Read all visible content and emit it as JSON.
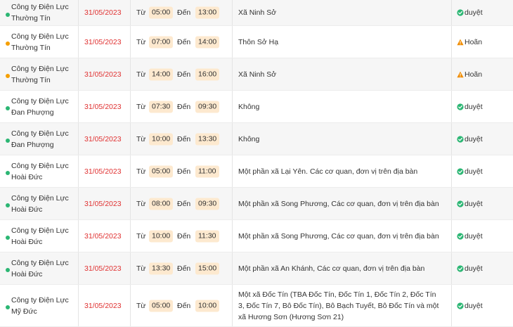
{
  "colors": {
    "dot_green": "#2bb673",
    "dot_orange": "#f59f00",
    "date_red": "#e03131",
    "time_badge_bg": "#fde9cf",
    "approved_icon": "#2bb673",
    "postponed_icon": "#f08c00"
  },
  "labels": {
    "from": "Từ",
    "to": "Đến"
  },
  "rows": [
    {
      "company": "Công ty Điện Lực Thường Tín",
      "date": "31/05/2023",
      "from": "05:00",
      "to": "13:00",
      "area": "Xã Ninh Sở",
      "status": "duyệt",
      "status_icon": "check-circle-icon",
      "dot": "green"
    },
    {
      "company": "Công ty Điện Lực Thường Tín",
      "date": "31/05/2023",
      "from": "07:00",
      "to": "14:00",
      "area": "Thôn Sở Hạ",
      "status": "Hoãn",
      "status_icon": "warning-icon",
      "dot": "orange"
    },
    {
      "company": "Công ty Điện Lực Thường Tín",
      "date": "31/05/2023",
      "from": "14:00",
      "to": "16:00",
      "area": "Xã Ninh Sở",
      "status": "Hoãn",
      "status_icon": "warning-icon",
      "dot": "orange"
    },
    {
      "company": "Công ty Điện Lực Đan Phượng",
      "date": "31/05/2023",
      "from": "07:30",
      "to": "09:30",
      "area": "Không",
      "status": "duyệt",
      "status_icon": "check-circle-icon",
      "dot": "green"
    },
    {
      "company": "Công ty Điện Lực Đan Phượng",
      "date": "31/05/2023",
      "from": "10:00",
      "to": "13:30",
      "area": "Không",
      "status": "duyệt",
      "status_icon": "check-circle-icon",
      "dot": "green"
    },
    {
      "company": "Công ty Điện Lực Hoài Đức",
      "date": "31/05/2023",
      "from": "05:00",
      "to": "11:00",
      "area": "Một phần xã Lại Yên. Các cơ quan, đơn vị trên địa bàn",
      "status": "duyệt",
      "status_icon": "check-circle-icon",
      "dot": "green"
    },
    {
      "company": "Công ty Điện Lực Hoài Đức",
      "date": "31/05/2023",
      "from": "08:00",
      "to": "09:30",
      "area": "Một phần xã Song Phương, Các cơ quan, đơn vị trên địa bàn",
      "status": "duyệt",
      "status_icon": "check-circle-icon",
      "dot": "green"
    },
    {
      "company": "Công ty Điện Lực Hoài Đức",
      "date": "31/05/2023",
      "from": "10:00",
      "to": "11:30",
      "area": "Một phần xã Song Phương, Các cơ quan, đơn vị trên địa bàn",
      "status": "duyệt",
      "status_icon": "check-circle-icon",
      "dot": "green"
    },
    {
      "company": "Công ty Điện Lực Hoài Đức",
      "date": "31/05/2023",
      "from": "13:30",
      "to": "15:00",
      "area": "Một phần xã An Khánh, Các cơ quan, đơn vị trên địa bàn",
      "status": "duyệt",
      "status_icon": "check-circle-icon",
      "dot": "green"
    },
    {
      "company": "Công ty Điện Lực Mỹ Đức",
      "date": "31/05/2023",
      "from": "05:00",
      "to": "10:00",
      "area": "Một xã Đốc Tín (TBA Đốc Tín, Đốc Tín 1, Đốc Tín 2, Đốc Tín 3, Đốc Tín 7, Bô Đốc Tín), Bô Bạch Tuyết, Bô Đốc Tín và một xã Hương Sơn (Hương Sơn 21)",
      "status": "duyệt",
      "status_icon": "check-circle-icon",
      "dot": "green"
    }
  ]
}
